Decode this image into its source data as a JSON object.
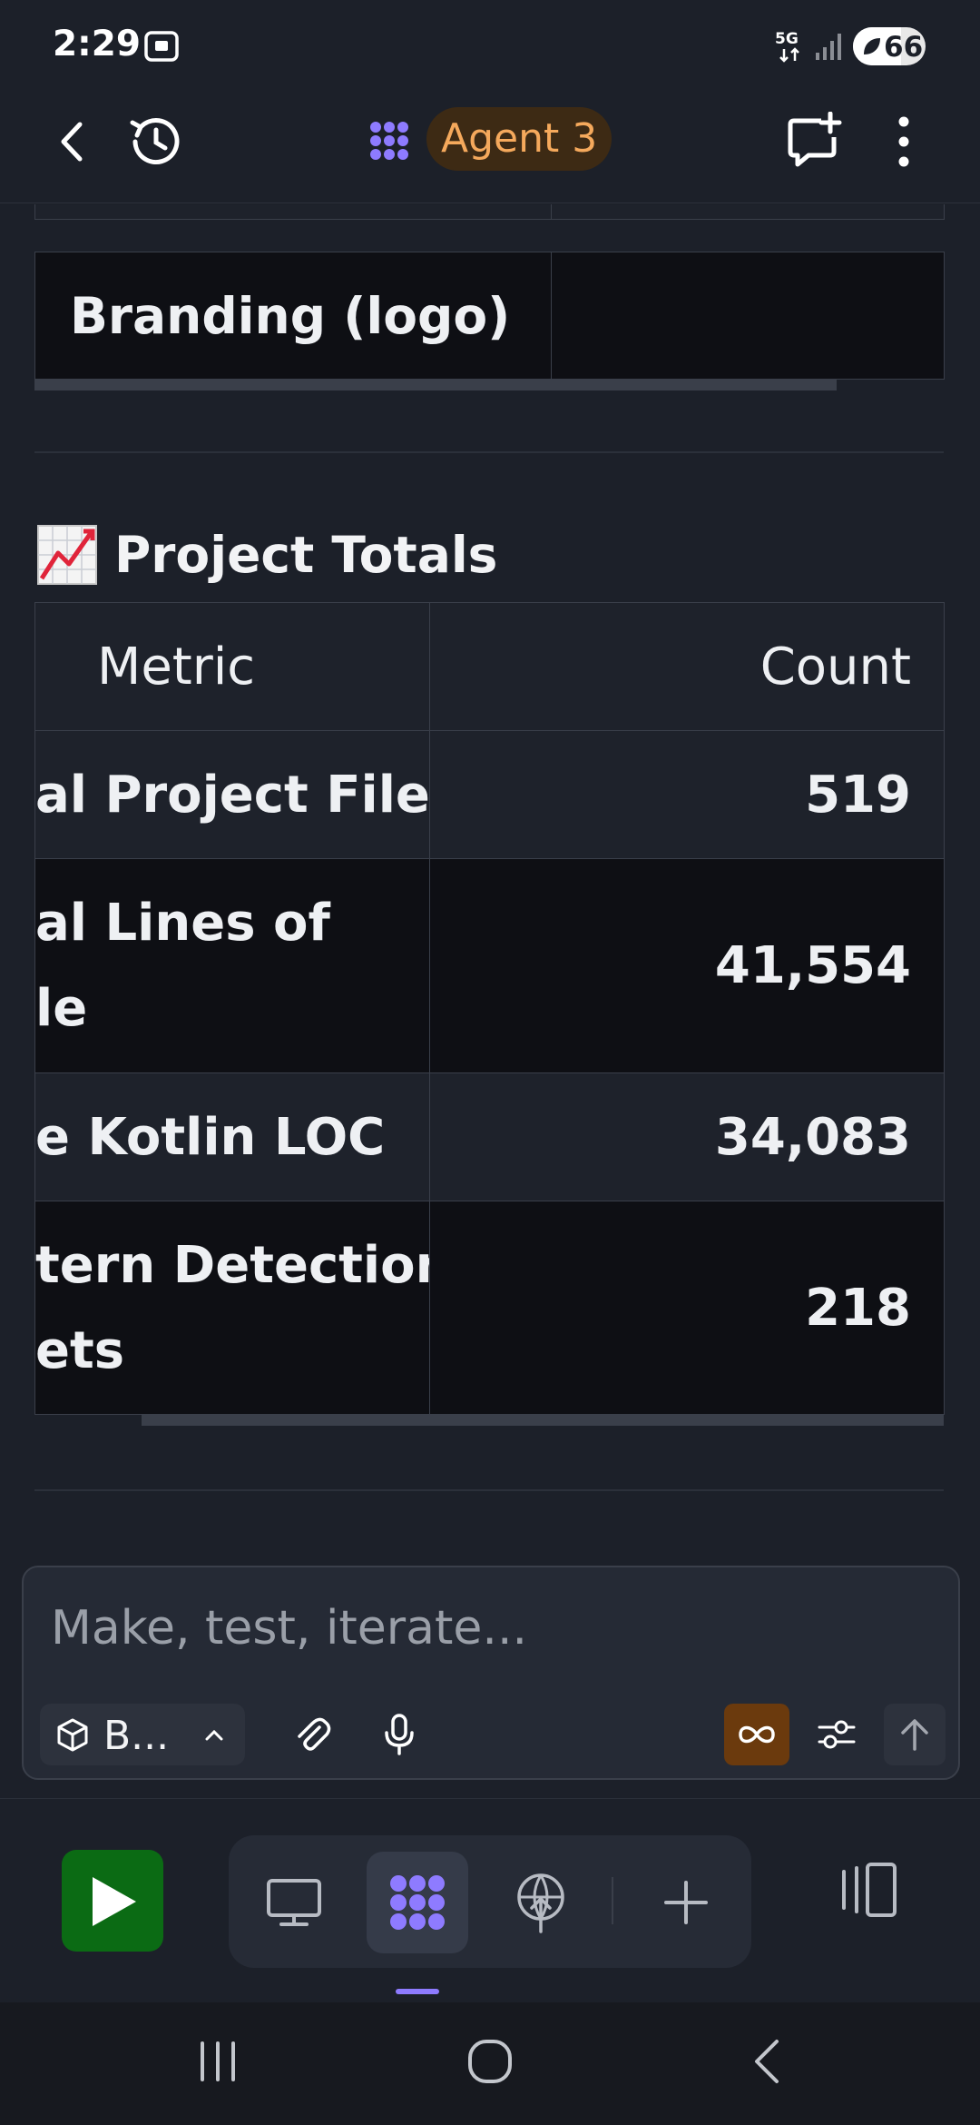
{
  "status_bar": {
    "time": "2:29",
    "network": "5G",
    "battery": "66",
    "battery_level_percent": 66
  },
  "app_bar": {
    "agent_label": "Agent 3",
    "icons": [
      "back-icon",
      "history-icon",
      "agent-logo-icon",
      "new-chat-icon",
      "more-vertical-icon"
    ]
  },
  "prev_table": {
    "rows": [
      {
        "feature": "",
        "value": ""
      },
      {
        "feature": "Branding (logo)",
        "value": ""
      }
    ]
  },
  "section": {
    "emoji": "📈",
    "title": "Project Totals"
  },
  "totals_table": {
    "headers": {
      "metric": "Metric",
      "count": "Count"
    },
    "rows": [
      {
        "metric_line1": "al Project Files",
        "metric_line2": "",
        "count": "519"
      },
      {
        "metric_line1": "al Lines of",
        "metric_line2": "le",
        "count": "41,554"
      },
      {
        "metric_line1": "e Kotlin LOC",
        "metric_line2": "",
        "count": "34,083"
      },
      {
        "metric_line1": "tern Detection",
        "metric_line2": "ets",
        "count": "218"
      }
    ]
  },
  "composer": {
    "placeholder": "Make, test, iterate...",
    "model_chip": "B...",
    "icons": [
      "cube-icon",
      "chevron-up-icon",
      "paperclip-icon",
      "microphone-icon",
      "infinity-icon",
      "sliders-icon",
      "arrow-up-icon"
    ]
  },
  "bottom_nav": {
    "icons": [
      "play-icon",
      "desktop-icon",
      "agent-icon",
      "deploy-icon",
      "plus-icon",
      "layout-icon"
    ]
  },
  "system_nav": {
    "icons": [
      "recents-icon",
      "home-icon",
      "back-icon"
    ]
  },
  "colors": {
    "background": "#1c2029",
    "accent_orange": "#f5a95c",
    "accent_purple": "#8e7bff",
    "run_green": "#0b6b14"
  }
}
